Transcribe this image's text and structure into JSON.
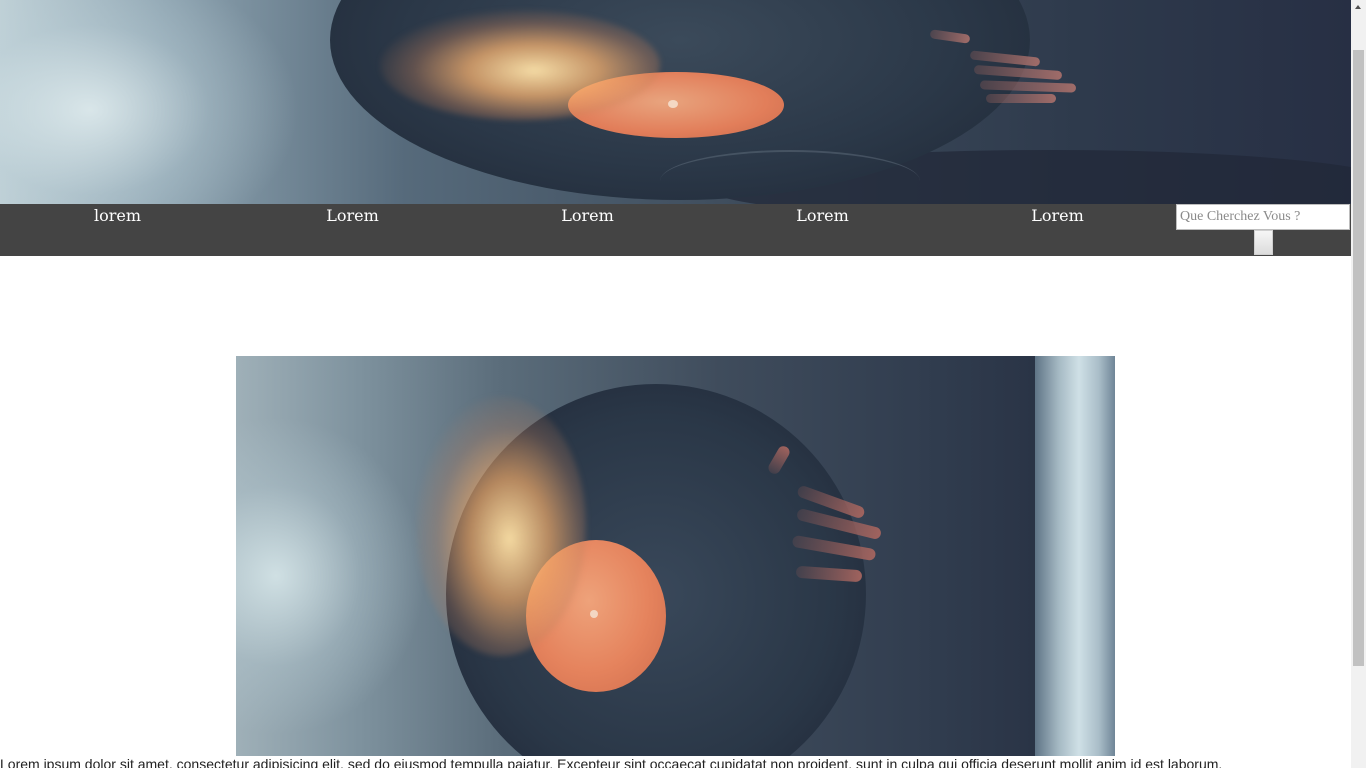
{
  "nav": {
    "items": [
      {
        "label": "lorem"
      },
      {
        "label": "Lorem"
      },
      {
        "label": "Lorem"
      },
      {
        "label": "Lorem"
      },
      {
        "label": "Lorem"
      }
    ]
  },
  "search": {
    "placeholder": "Que Cherchez Vous ?",
    "value": ""
  },
  "content": {
    "paragraph": "Lorem ipsum dolor sit amet, consectetur adipisicing elit, sed do eiusmod tempulla paiatur. Excepteur sint occaecat cupidatat non proident, sunt in culpa qui officia deserunt mollit anim id est laborum."
  },
  "colors": {
    "nav_background": "#444444",
    "nav_text": "#ffffff",
    "page_background": "#ffffff"
  }
}
